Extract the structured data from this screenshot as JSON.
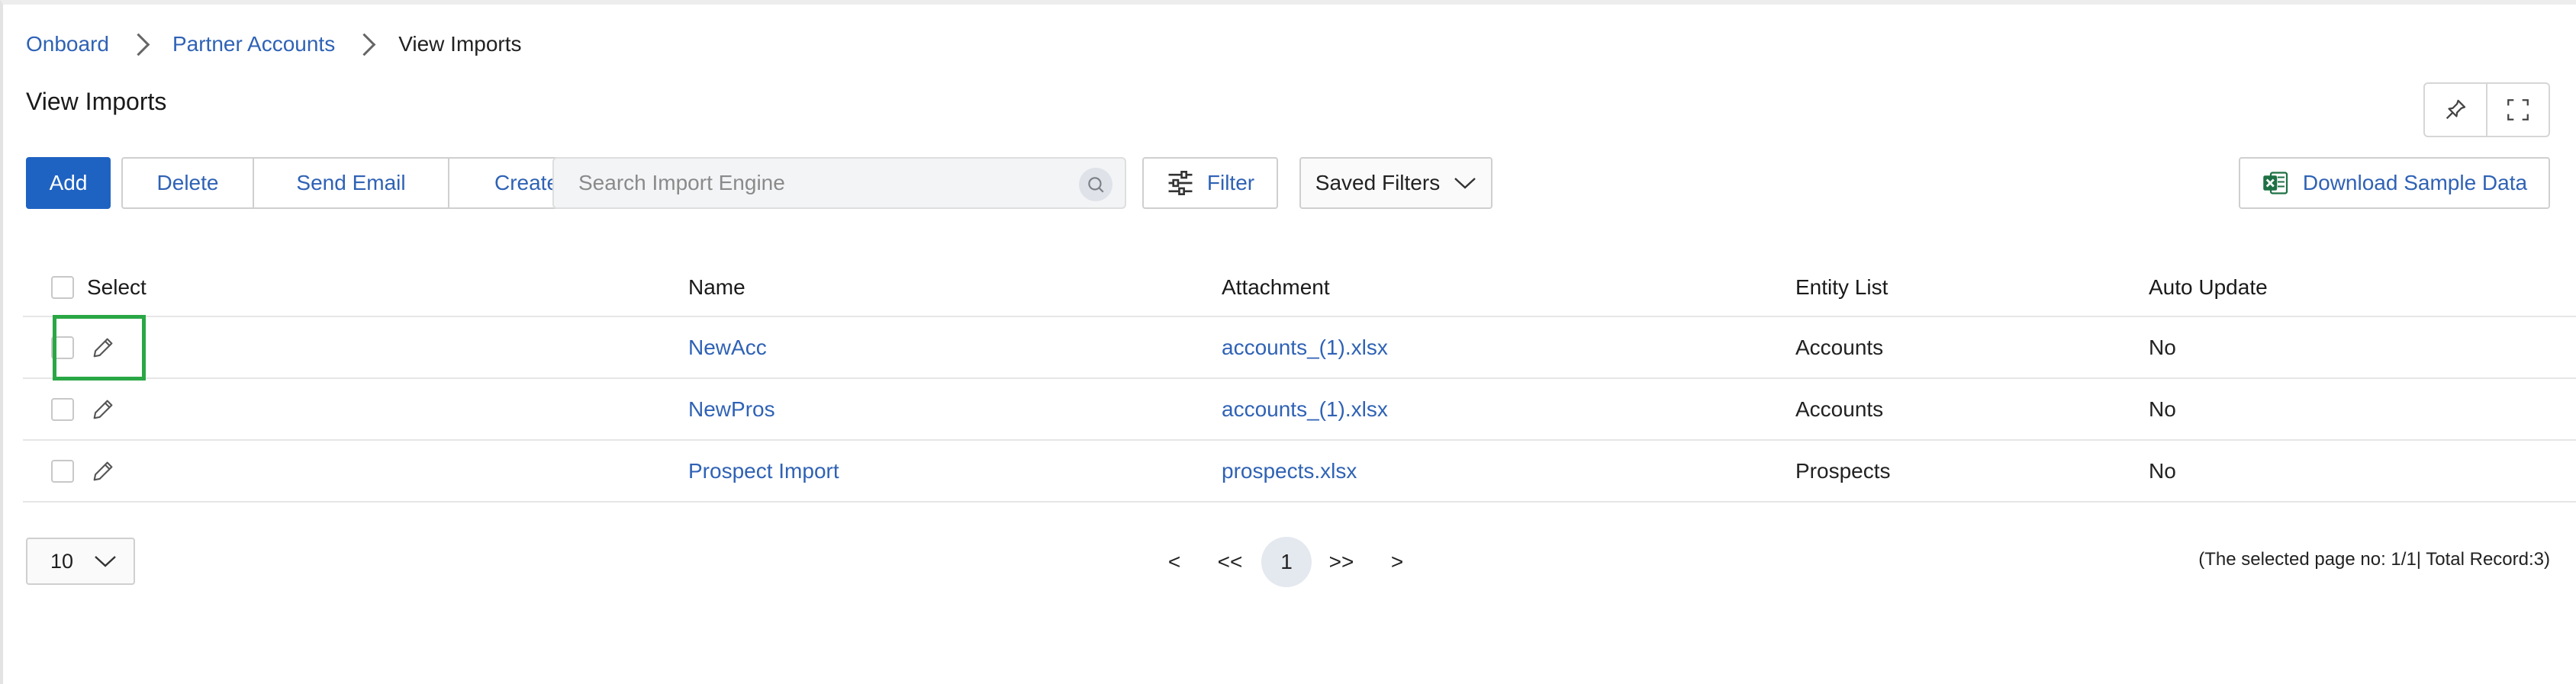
{
  "breadcrumb": {
    "items": [
      "Onboard",
      "Partner Accounts"
    ],
    "current": "View Imports"
  },
  "page_title": "View Imports",
  "toolbar": {
    "add_label": "Add",
    "delete_label": "Delete",
    "send_email_label": "Send Email",
    "create_view_label": "Create View",
    "search_placeholder": "Search Import Engine",
    "filter_label": "Filter",
    "saved_filters_label": "Saved Filters",
    "download_label": "Download Sample Data"
  },
  "table": {
    "columns": [
      "Select",
      "Name",
      "Attachment",
      "Entity List",
      "Auto Update"
    ],
    "rows": [
      {
        "name": "NewAcc",
        "attachment": "accounts_(1).xlsx",
        "entity": "Accounts",
        "auto_update": "No"
      },
      {
        "name": "NewPros",
        "attachment": "accounts_(1).xlsx",
        "entity": "Accounts",
        "auto_update": "No"
      },
      {
        "name": "Prospect Import",
        "attachment": "prospects.xlsx",
        "entity": "Prospects",
        "auto_update": "No"
      }
    ]
  },
  "pagination": {
    "page_size": "10",
    "prev": "<",
    "first": "<<",
    "current_page": "1",
    "last": ">>",
    "next": ">",
    "summary": "(The selected page no: 1/1| Total Record:3)"
  },
  "colors": {
    "primary": "#1f63c2",
    "link": "#2f62b5",
    "highlight": "#2aa745",
    "excel": "#1e7145"
  }
}
